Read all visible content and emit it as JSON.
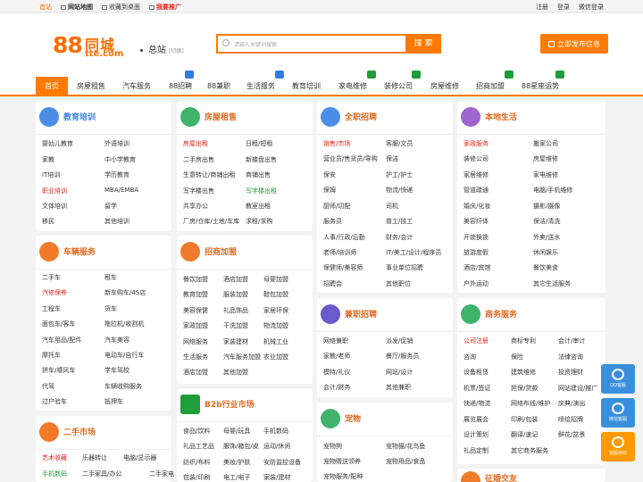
{
  "topbar": {
    "home": "首站",
    "map": "网站地图",
    "fav": "收藏到桌面",
    "promo": "我要推广",
    "login": "注册",
    "reg": "登录",
    "wx": "微信登录"
  },
  "logo": {
    "num": "88",
    "city": "同城",
    "domain": "tte.com"
  },
  "city": {
    "name": "总站",
    "switch": "[切换]"
  },
  "search": {
    "placeholder": "请输入关键词搜索",
    "button": "搜 索"
  },
  "post": {
    "label": "立即发布信息"
  },
  "nav": [
    "首页",
    "房屋租售",
    "汽车服务",
    "88招聘",
    "88兼职",
    "生活服务",
    "教育培训",
    "家电维修",
    "装修公司",
    "房屋维修",
    "招商加盟",
    "88星座运势"
  ],
  "cards": {
    "edu": {
      "title": "教育培训",
      "links": [
        "婴幼儿教育",
        "外语培训",
        "家教",
        "中小学教育",
        "IT培训",
        "学历教育",
        "职业培训",
        "MBA/EMBA",
        "文体培训",
        "留学",
        "移民",
        "其他培训"
      ]
    },
    "house": {
      "title": "房屋租售",
      "links": [
        "房屋出租",
        "日租/短租",
        "二手房出售",
        "新楼盘出售",
        "生意转让/商铺出租",
        "商铺出售",
        "写字楼出售",
        "写字楼出租",
        "共享办公",
        "教室出租",
        "厂房/仓库/土地/车库",
        "求租/求购"
      ]
    },
    "job": {
      "title": "全职招聘",
      "links": [
        "销售/市场",
        "客服/文员",
        "营业员/售货员/导购",
        "保洁",
        "保安",
        "护工/护士",
        "保姆",
        "物流/快递",
        "厨师/切配",
        "司机",
        "服务员",
        "普工/技工",
        "人事/行政/后勤",
        "财务/会计",
        "老师/培训师",
        "IT/美工/设计/程序员",
        "保健师/美容师",
        "事业单位招聘",
        "招聘会",
        "其他职位"
      ]
    },
    "life": {
      "title": "本地生活",
      "links": [
        "家政服务",
        "搬家公司",
        "装修公司",
        "房屋维修",
        "家居维修",
        "家电维修",
        "管道疏通",
        "电脑/手机维修",
        "婚庆/化妆",
        "摄影/摄像",
        "美容纤体",
        "保洁/清洗",
        "开锁换锁",
        "外卖/送水",
        "旅游度假",
        "休闲娱乐",
        "酒店/宾馆",
        "餐饮美食",
        "户外运动",
        "其它生活服务"
      ]
    },
    "car": {
      "title": "车辆服务",
      "links": [
        "二手车",
        "租车",
        "汽修保养",
        "新车购车/4S店",
        "工程车",
        "货车",
        "面包车/客车",
        "拖拉机/收割机",
        "汽车用品/配件",
        "汽车美容",
        "摩托车",
        "电动车/自行车",
        "拼车/顺风车",
        "学车驾校",
        "代驾",
        "车辆收购服务",
        "过户验车",
        "抵押车"
      ]
    },
    "franchise": {
      "title": "招商加盟",
      "links": [
        "餐饮加盟",
        "酒店加盟",
        "母婴加盟",
        "教育加盟",
        "服装加盟",
        "鞋包加盟",
        "美容保健",
        "礼品饰品",
        "家居环保",
        "家政加盟",
        "干洗加盟",
        "物流加盟",
        "网络服务",
        "家装建材",
        "机械工业",
        "生活服务",
        "汽车服务加盟",
        "农业加盟",
        "酒店加盟",
        "其他加盟"
      ]
    },
    "parttime": {
      "title": "兼职招聘",
      "links": [
        "网络兼职",
        "派发/促销",
        "家教/老师",
        "餐厅/服务员",
        "模特/礼仪",
        "网站/设计",
        "会计/财务",
        "其他兼职"
      ]
    },
    "biz": {
      "title": "商务服务",
      "links": [
        "公司注册",
        "商标专利",
        "会计/审计",
        "咨询",
        "保险",
        "法律咨询",
        "设备租赁",
        "建筑维修",
        "投资理财",
        "机票/签证",
        "担保/贷款",
        "网站建设/推广",
        "快递/物流",
        "网络布线/维护",
        "庆典/演出",
        "展览展会",
        "印刷/包装",
        "喷绘招牌",
        "设计策划",
        "翻译/速记",
        "鲜花/盆景",
        "礼品定制",
        "其它商务服务"
      ]
    },
    "used": {
      "title": "二手市场",
      "links": [
        "艺术收藏",
        "乐器转让",
        "电脑/显示器",
        "手机数码",
        "二手家具/办公",
        "二手家电"
      ]
    },
    "b2b": {
      "title": "B2b行业市场",
      "links": [
        "食品/饮料",
        "母婴/玩具",
        "手机数码",
        "礼品工艺品",
        "服饰/箱包/皮",
        "运动/休闲",
        "纺织/布料",
        "美妆/护肤",
        "安防监控设备",
        "包装/印刷",
        "电工/电子",
        "家装/建材"
      ]
    },
    "pet": {
      "title": "宠物",
      "links": [
        "宠物狗",
        "宠物猫/花鸟鱼",
        "宠物赠送领养",
        "宠物用品/食品",
        "宠物服务/配种"
      ]
    },
    "dating": {
      "title": "征婚交友"
    }
  },
  "side": [
    "QQ客服",
    "微信客服",
    "客服热线"
  ],
  "colors": {
    "accent": "#ff7a00",
    "hot": "#e0251a",
    "green": "#1f9d3a"
  }
}
